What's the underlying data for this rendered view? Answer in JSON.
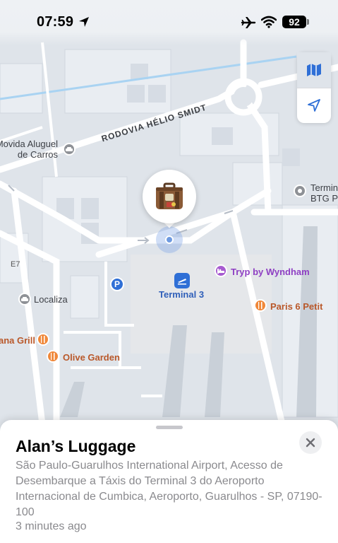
{
  "status_bar": {
    "time": "07:59",
    "battery": "92"
  },
  "map": {
    "road_name": "RODOVIA HÉLIO SMIDT",
    "road_code": "E7",
    "labels": {
      "aluguel_line1": "Movida Aluguel",
      "aluguel_line2": "de Carros",
      "terminal_right_line1": "Termin",
      "terminal_right_line2": "BTG Pa",
      "localiza": "Localiza",
      "terminal3": "Terminal 3",
      "tryp": "Tryp by Wyndham",
      "paris": "Paris 6 Petit",
      "grill": "ana Grill",
      "olive": "Olive Garden"
    },
    "icons": {
      "luggage": "luggage-emoji",
      "parking": "P"
    }
  },
  "sheet": {
    "title": "Alan’s Luggage",
    "address": "São Paulo-Guarulhos International Airport, Acesso de Desembarque a Táxis do Terminal 3 do Aeroporto Internacional de Cumbica, Aeroporto, Guarulhos - SP, 07190-100",
    "time_ago": "3 minutes ago"
  },
  "colors": {
    "poi_orange": "#f0883a",
    "poi_purple": "#a75bd0",
    "accent_blue": "#2f6fd6"
  }
}
